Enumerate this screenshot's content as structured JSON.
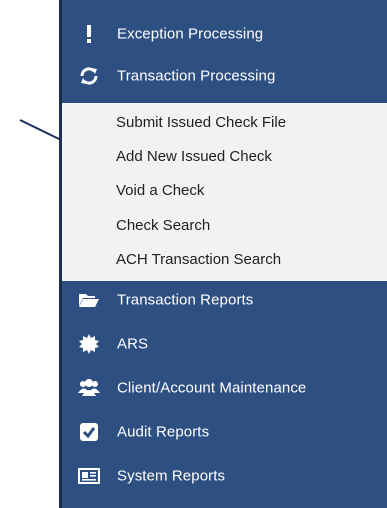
{
  "nav": {
    "top_items": [
      {
        "label": "Exception Processing",
        "icon": "exclamation-icon"
      },
      {
        "label": "Transaction Processing",
        "icon": "refresh-icon"
      }
    ],
    "submenu": [
      "Submit Issued Check File",
      "Add New Issued Check",
      "Void a Check",
      "Check Search",
      "ACH Transaction Search"
    ],
    "bottom_items": [
      {
        "label": "Transaction Reports",
        "icon": "folder-open-icon"
      },
      {
        "label": "ARS",
        "icon": "gear-burst-icon"
      },
      {
        "label": "Client/Account Maintenance",
        "icon": "users-icon"
      },
      {
        "label": "Audit Reports",
        "icon": "check-square-icon"
      },
      {
        "label": "System Reports",
        "icon": "newspaper-icon"
      }
    ]
  },
  "colors": {
    "nav_bg": "#2e4f82",
    "submenu_bg": "#f2f2f2",
    "arrow": "#1b2e5a"
  }
}
